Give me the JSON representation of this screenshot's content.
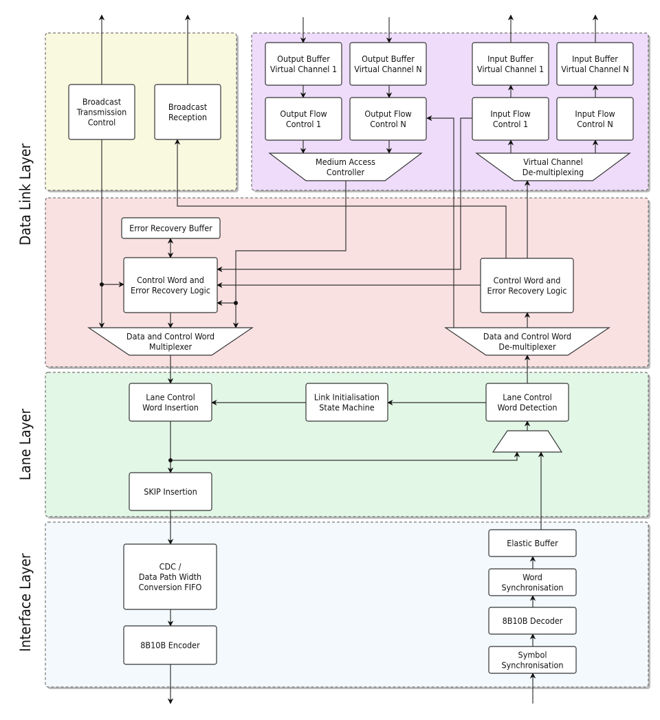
{
  "layers": {
    "data_link": "Data Link Layer",
    "lane": "Lane Layer",
    "interface": "Interface Layer"
  },
  "colors": {
    "broadcast_panel": "#f9f9e0",
    "virtual_channel_panel": "#eedcfa",
    "data_link_panel": "#fae1e1",
    "lane_panel": "#e2f7e6",
    "interface_panel": "#f3f9fd"
  },
  "blocks": {
    "broadcast_tx": [
      "Broadcast",
      "Transmission",
      "Control"
    ],
    "broadcast_rx": [
      "Broadcast",
      "Reception"
    ],
    "out_buf_1": [
      "Output Buffer",
      "Virtual Channel 1"
    ],
    "out_buf_n": [
      "Output Buffer",
      "Virtual Channel N"
    ],
    "out_flow_1": [
      "Output Flow",
      "Control 1"
    ],
    "out_flow_n": [
      "Output Flow",
      "Control N"
    ],
    "in_buf_1": [
      "Input Buffer",
      "Virtual Channel 1"
    ],
    "in_buf_n": [
      "Input Buffer",
      "Virtual Channel N"
    ],
    "in_flow_1": [
      "Input Flow",
      "Control 1"
    ],
    "in_flow_n": [
      "Input Flow",
      "Control N"
    ],
    "mac": [
      "Medium Access",
      "Controller"
    ],
    "vc_demux": [
      "Virtual Channel",
      "De-multiplexing"
    ],
    "err_buf": [
      "Error Recovery Buffer"
    ],
    "cw_logic_tx": [
      "Control Word and",
      "Error Recovery Logic"
    ],
    "cw_logic_rx": [
      "Control Word and",
      "Error Recovery Logic"
    ],
    "mux": [
      "Data and Control Word",
      "Multiplexer"
    ],
    "demux": [
      "Data and Control Word",
      "De-multiplexer"
    ],
    "lane_cw_ins": [
      "Lane Control",
      "Word Insertion"
    ],
    "link_init": [
      "Link Initialisation",
      "State Machine"
    ],
    "lane_cw_det": [
      "Lane Control",
      "Word Detection"
    ],
    "skip_ins": [
      "SKIP Insertion"
    ],
    "cdc_fifo": [
      "CDC /",
      "Data Path Width",
      "Conversion FIFO"
    ],
    "encoder": [
      "8B10B Encoder"
    ],
    "elastic": [
      "Elastic Buffer"
    ],
    "word_sync": [
      "Word",
      "Synchronisation"
    ],
    "decoder": [
      "8B10B Decoder"
    ],
    "symbol_sync": [
      "Symbol",
      "Synchronisation"
    ]
  }
}
